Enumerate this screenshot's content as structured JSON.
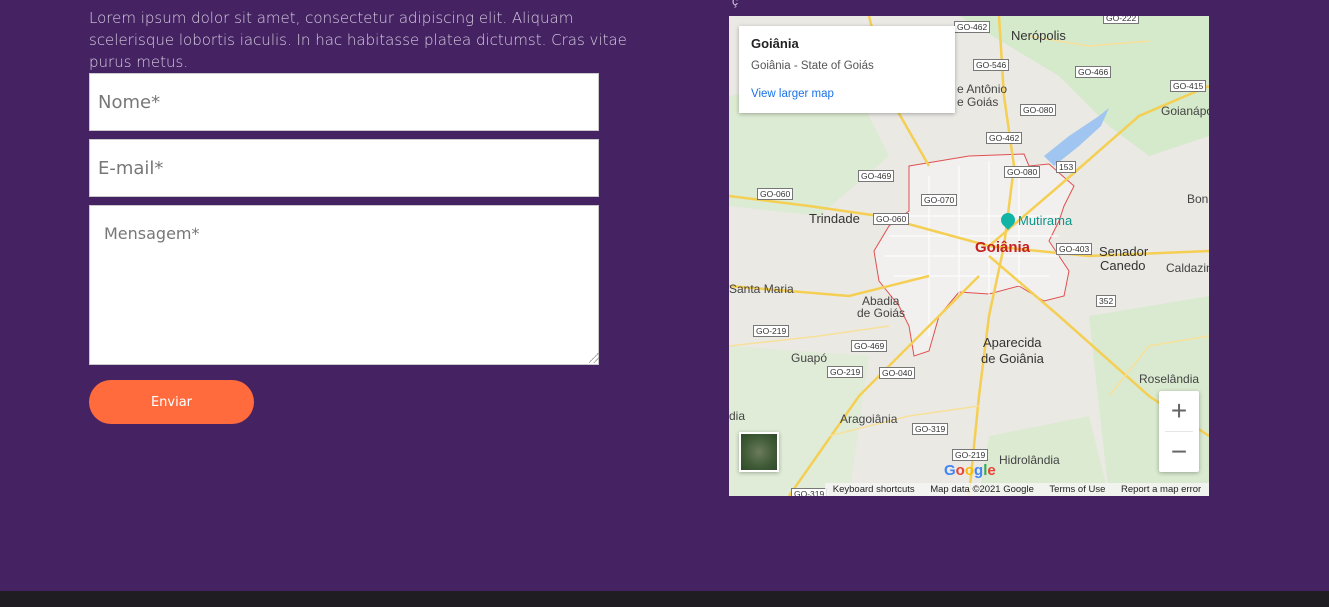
{
  "intro": "Lorem ipsum dolor sit amet, consectetur adipiscing elit. Aliquam scelerisque lobortis iaculis. In hac habitasse platea dictumst. Cras vitae purus metus.",
  "form": {
    "name_placeholder": "Nome*",
    "email_placeholder": "E-mail*",
    "message_placeholder": "Mensagem*",
    "submit_label": "Enviar"
  },
  "map": {
    "info_title": "Goiânia",
    "info_address": "Goiânia - State of Goiás",
    "info_link": "View larger map",
    "labels": {
      "nerópolis": "Nerópolis",
      "santo_antonio": "e Antônio",
      "de_goias": "e Goiás",
      "goianapolis": "Goianápolis",
      "trindade": "Trindade",
      "mutirama": "Mutirama",
      "goiania": "Goiânia",
      "senador": "Senador",
      "canedo": "Canedo",
      "bon": "Bon",
      "caldazin": "Caldazin",
      "santa_maria": "Santa Maria",
      "abadia": "Abadia",
      "abadia_de_goias": "de Goiás",
      "aparecida": "Aparecida",
      "aparecida2": "de Goiânia",
      "guapo": "Guapó",
      "roselandia": "Roselândia",
      "aragoiania": "Aragoiânia",
      "hidrolandia": "Hidrolândia",
      "dia": "dia"
    },
    "shields": {
      "go462a": "GO-462",
      "go222": "GO-222",
      "go546": "GO-546",
      "go466": "GO-466",
      "go415": "GO-415",
      "go080a": "GO-080",
      "go462b": "GO-462",
      "go080b": "GO-080",
      "r153": "153",
      "go469a": "GO-469",
      "go060a": "GO-060",
      "go070": "GO-070",
      "go060b": "GO-060",
      "go403": "GO-403",
      "r352": "352",
      "go219a": "GO-219",
      "go469b": "GO-469",
      "go219b": "GO-219",
      "go040": "GO-040",
      "go319a": "GO-319",
      "go219c": "GO-219",
      "go319b": "GO-319"
    },
    "google_logo": "Google",
    "attribution": {
      "shortcuts": "Keyboard shortcuts",
      "data": "Map data ©2021 Google",
      "terms": "Terms of Use",
      "report": "Report a map error"
    },
    "zoom_in": "+",
    "zoom_out": "−"
  },
  "colors": {
    "background": "#452262",
    "button": "#ff6b3c",
    "footer": "#1f1d22"
  }
}
